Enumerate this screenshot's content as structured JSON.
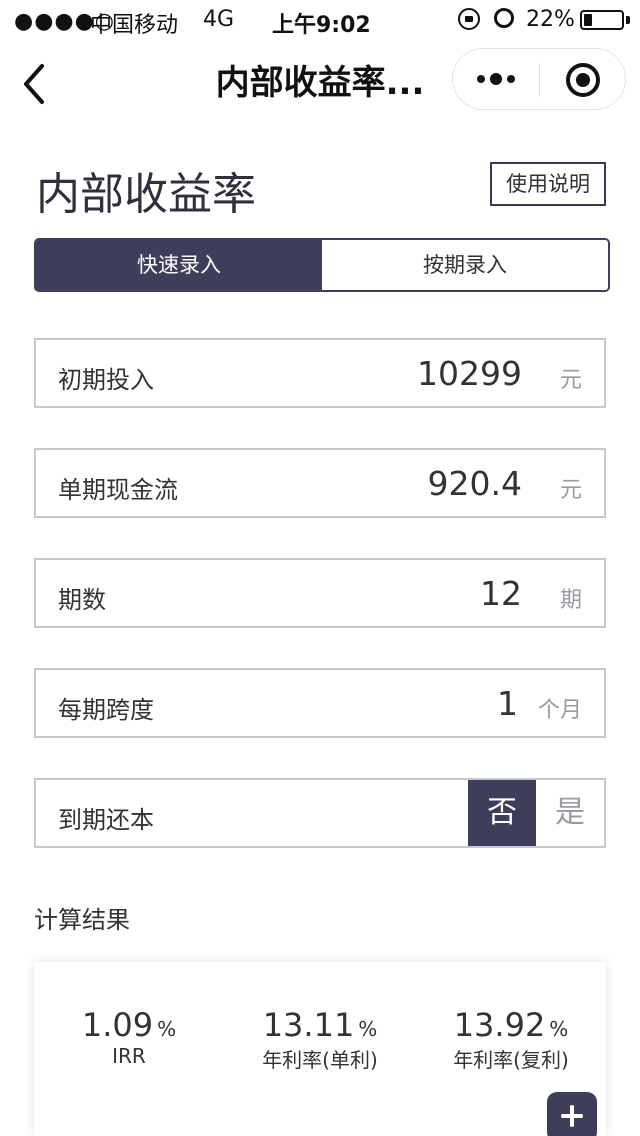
{
  "status_bar": {
    "signal": "●●●●○",
    "carrier": "中国移动",
    "network": "4G",
    "time": "上午9:02",
    "battery_percent": "22%",
    "battery_level": 0.22
  },
  "nav": {
    "title": "内部收益率..."
  },
  "header": {
    "title": "内部收益率",
    "help_label": "使用说明"
  },
  "tabs": [
    {
      "label": "快速录入",
      "active": true
    },
    {
      "label": "按期录入",
      "active": false
    }
  ],
  "fields": {
    "initial_investment": {
      "label": "初期投入",
      "value": "10299",
      "unit": "元"
    },
    "cash_flow": {
      "label": "单期现金流",
      "value": "920.4",
      "unit": "元"
    },
    "periods": {
      "label": "期数",
      "value": "12",
      "unit": "期"
    },
    "span": {
      "label": "每期跨度",
      "value": "1",
      "unit": "个月"
    },
    "principal_at_maturity": {
      "label": "到期还本",
      "options": [
        "否",
        "是"
      ],
      "selected": "否"
    }
  },
  "results": {
    "label": "计算结果",
    "items": [
      {
        "value": "1.09",
        "unit": "%",
        "name": "IRR"
      },
      {
        "value": "13.11",
        "unit": "%",
        "name": "年利率(单利)"
      },
      {
        "value": "13.92",
        "unit": "%",
        "name": "年利率(复利)"
      }
    ]
  },
  "colors": {
    "accent": "#3e3d5a",
    "border": "#c7c7cf",
    "muted": "#9a9aa2"
  }
}
